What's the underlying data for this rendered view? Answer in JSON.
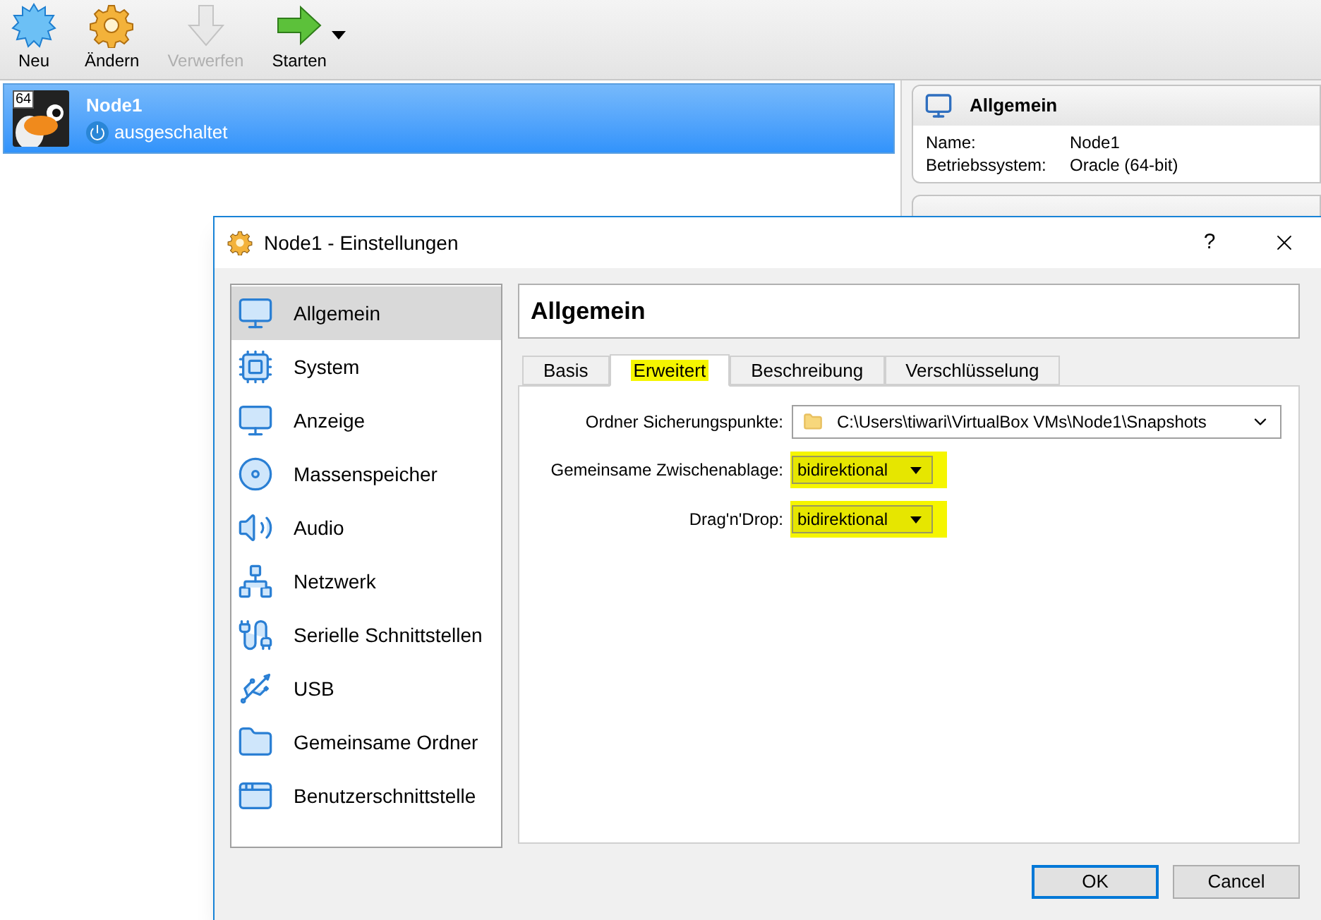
{
  "toolbar": {
    "buttons": [
      {
        "label": "Neu",
        "disabled": false
      },
      {
        "label": "Ändern",
        "disabled": false
      },
      {
        "label": "Verwerfen",
        "disabled": true
      },
      {
        "label": "Starten",
        "disabled": false
      }
    ]
  },
  "vm_list": [
    {
      "name": "Node1",
      "badge": "64",
      "state": "ausgeschaltet",
      "selected": true
    }
  ],
  "details": {
    "sections": [
      {
        "title": "Allgemein",
        "rows": [
          {
            "label": "Name:",
            "value": "Node1"
          },
          {
            "label": "Betriebssystem:",
            "value": "Oracle (64-bit)"
          }
        ]
      }
    ]
  },
  "dialog": {
    "title": "Node1 - Einstellungen",
    "help": "?",
    "sidebar": [
      {
        "label": "Allgemein",
        "selected": true
      },
      {
        "label": "System",
        "selected": false
      },
      {
        "label": "Anzeige",
        "selected": false
      },
      {
        "label": "Massenspeicher",
        "selected": false
      },
      {
        "label": "Audio",
        "selected": false
      },
      {
        "label": "Netzwerk",
        "selected": false
      },
      {
        "label": "Serielle Schnittstellen",
        "selected": false
      },
      {
        "label": "USB",
        "selected": false
      },
      {
        "label": "Gemeinsame Ordner",
        "selected": false
      },
      {
        "label": "Benutzerschnittstelle",
        "selected": false
      }
    ],
    "page_title": "Allgemein",
    "tabs": [
      {
        "label": "Basis",
        "selected": false,
        "highlighted": false
      },
      {
        "label": "Erweitert",
        "selected": true,
        "highlighted": true
      },
      {
        "label": "Beschreibung",
        "selected": false,
        "highlighted": false
      },
      {
        "label": "Verschlüsselung",
        "selected": false,
        "highlighted": false
      }
    ],
    "fields": [
      {
        "kind": "path",
        "label": "Ordner Sicherungspunkte:",
        "value": "C:\\Users\\tiwari\\VirtualBox VMs\\Node1\\Snapshots"
      },
      {
        "kind": "combo",
        "label": "Gemeinsame Zwischenablage:",
        "value": "bidirektional",
        "highlighted": true
      },
      {
        "kind": "combo",
        "label": "Drag'n'Drop:",
        "value": "bidirektional",
        "highlighted": true
      }
    ],
    "buttons": [
      {
        "label": "OK",
        "default": true
      },
      {
        "label": "Cancel",
        "default": false
      }
    ]
  }
}
